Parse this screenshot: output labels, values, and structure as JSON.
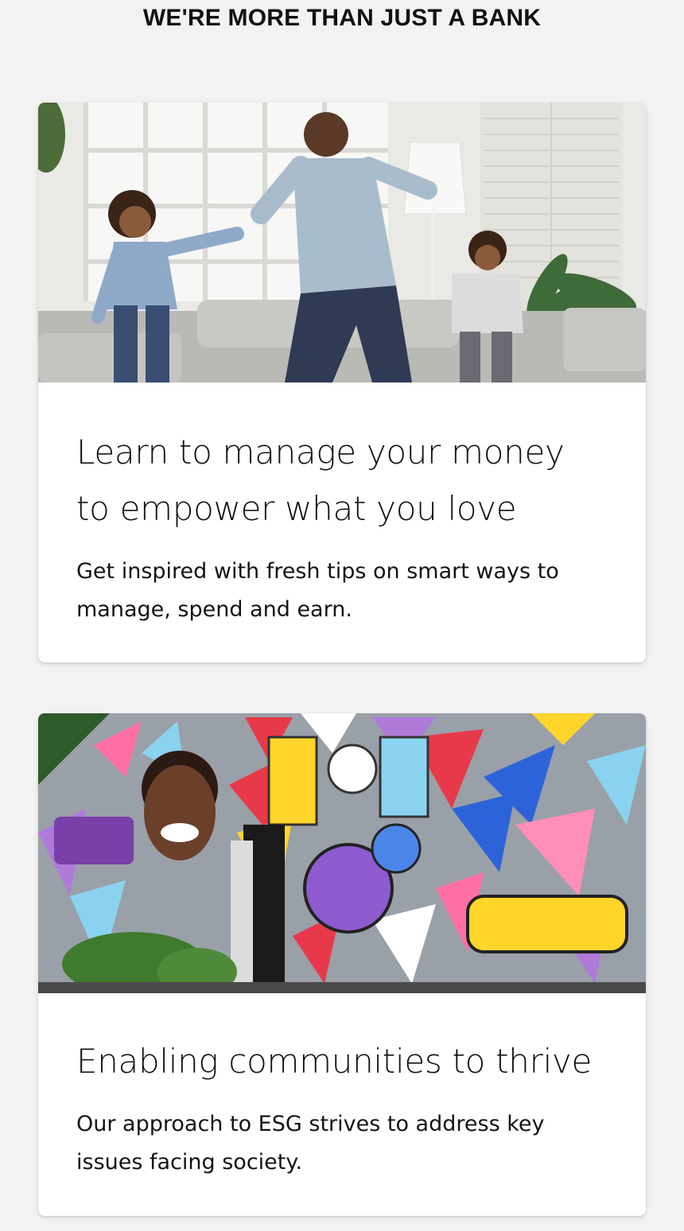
{
  "section": {
    "title": "WE'RE MORE THAN JUST A BANK"
  },
  "cards": [
    {
      "image_icon": "family-dancing-photo",
      "heading": "Learn to manage your money to empower what you love",
      "text": "Get inspired with fresh tips on smart ways to manage, spend and earn."
    },
    {
      "image_icon": "community-mural-photo",
      "heading": "Enabling communities to thrive",
      "text": "Our approach to ESG strives to address key issues facing society."
    }
  ],
  "colors": {
    "background": "#f2f2f2",
    "card": "#ffffff",
    "text": "#141414"
  }
}
